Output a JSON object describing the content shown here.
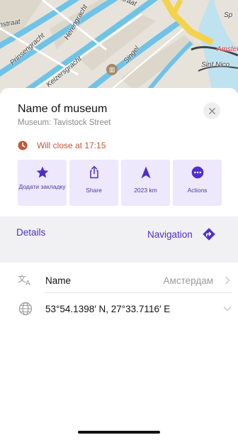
{
  "map": {
    "street_labels": [
      "instraat",
      "Prinsengracht",
      "Keizersgracht",
      "Herengracht",
      "Singel",
      "Amstel",
      "Sint Nico",
      "Sp",
      "straat"
    ],
    "poi_icons": [
      "museum-icon"
    ]
  },
  "place": {
    "title": "Name of museum",
    "subtitle": "Museum: Tavistock Street",
    "hours_text": "Will close at 17:15",
    "close_icon": "close-icon"
  },
  "actions": [
    {
      "label": "Додати закладку",
      "icon": "star-icon"
    },
    {
      "label": "Share",
      "icon": "share-icon"
    },
    {
      "label": "2023 km",
      "icon": "navigation-arrow-icon"
    },
    {
      "label": "Actions",
      "icon": "more-icon"
    }
  ],
  "tabs": {
    "details": "Details",
    "navigation": "Navigation"
  },
  "info_rows": [
    {
      "label": "Name",
      "value": "Амстердам",
      "icon": "translate-icon"
    },
    {
      "label": "53°54.1398′ N, 27°33.7116′ E",
      "value": "",
      "icon": "globe-icon"
    }
  ],
  "colors": {
    "accent": "#4e2fc9",
    "action_bg": "#ede8fb",
    "hours": "#c2573a",
    "canal": "#6ec3e8"
  }
}
